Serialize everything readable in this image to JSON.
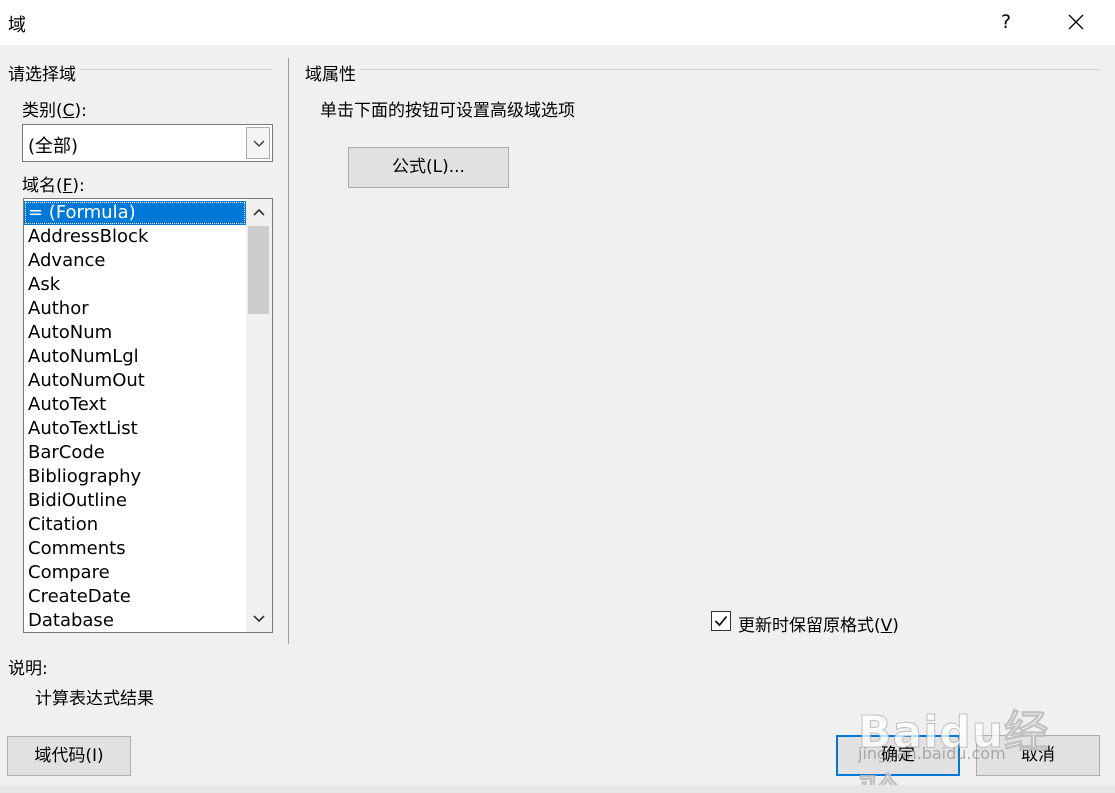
{
  "window": {
    "title": "域",
    "help_label": "?"
  },
  "select_field": {
    "group_label": "请选择域",
    "category_label": "类别(",
    "category_mnemonic": "C",
    "category_label_end": "):",
    "category_value": "(全部)",
    "field_names_label": "域名(",
    "field_names_mnemonic": "F",
    "field_names_label_end": "):",
    "field_names": [
      "= (Formula)",
      "AddressBlock",
      "Advance",
      "Ask",
      "Author",
      "AutoNum",
      "AutoNumLgl",
      "AutoNumOut",
      "AutoText",
      "AutoTextList",
      "BarCode",
      "Bibliography",
      "BidiOutline",
      "Citation",
      "Comments",
      "Compare",
      "CreateDate",
      "Database"
    ],
    "selected_index": 0
  },
  "field_properties": {
    "group_label": "域属性",
    "instruction": "单击下面的按钮可设置高级域选项",
    "formula_button": "公式(L)...",
    "preserve_format_label": "更新时保留原格式(",
    "preserve_format_mnemonic": "V",
    "preserve_format_label_end": ")",
    "preserve_format_checked": true
  },
  "description": {
    "label": "说明:",
    "text": "计算表达式结果"
  },
  "buttons": {
    "field_codes": "域代码(I)",
    "ok": "确定",
    "cancel": "取消"
  },
  "watermark": {
    "text": "Baidu经验",
    "url": "jingyan.baidu.com"
  }
}
